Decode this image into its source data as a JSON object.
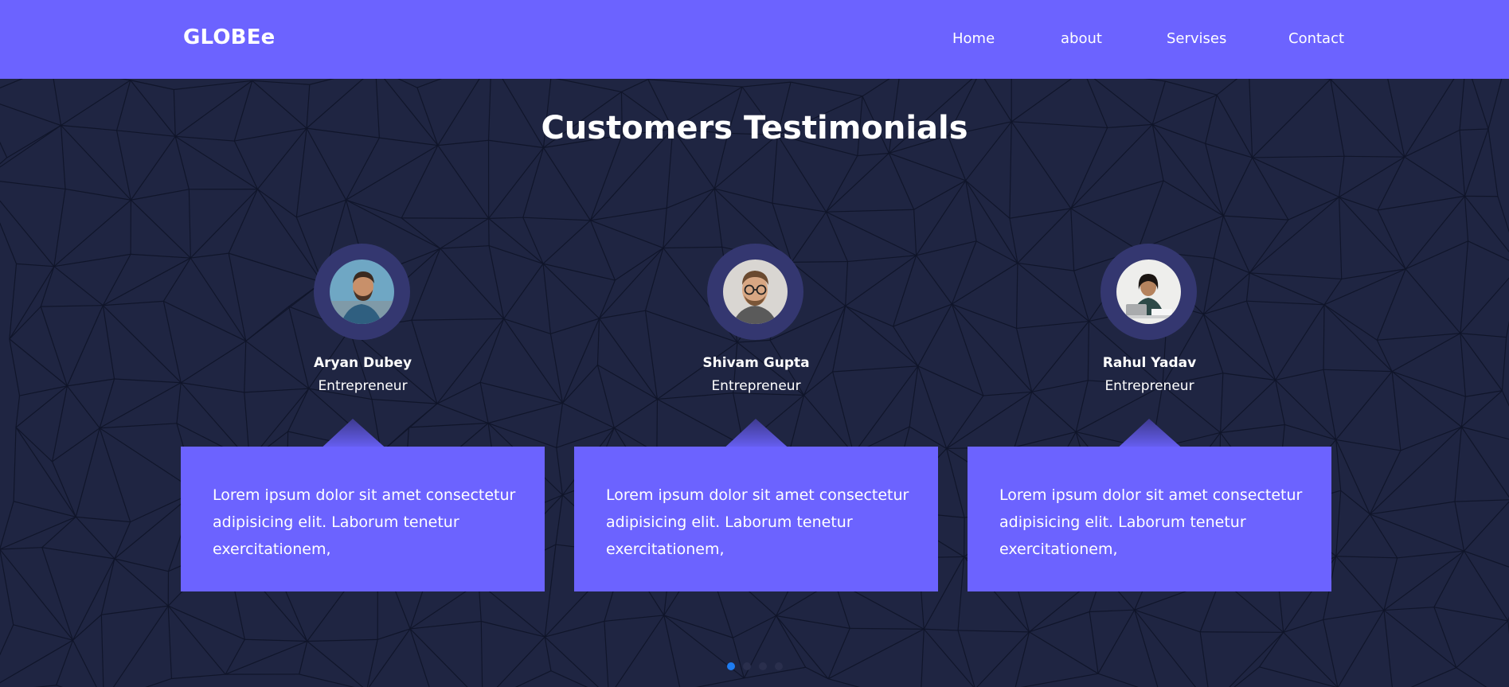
{
  "header": {
    "brand": "GLOBEe",
    "nav": [
      {
        "label": "Home"
      },
      {
        "label": "about"
      },
      {
        "label": "Servises"
      },
      {
        "label": "Contact"
      }
    ]
  },
  "section": {
    "title": "Customers Testimonials"
  },
  "testimonials": [
    {
      "name": "Aryan Dubey",
      "role": "Entrepreneur",
      "text": "Lorem ipsum dolor sit amet consectetur adipisicing elit. Laborum tenetur exercitationem,",
      "avatar_icon": "man-beard-portrait"
    },
    {
      "name": "Shivam Gupta",
      "role": "Entrepreneur",
      "text": "Lorem ipsum dolor sit amet consectetur adipisicing elit. Laborum tenetur exercitationem,",
      "avatar_icon": "man-glasses-portrait"
    },
    {
      "name": "Rahul Yadav",
      "role": "Entrepreneur",
      "text": "Lorem ipsum dolor sit amet consectetur adipisicing elit. Laborum tenetur exercitationem,",
      "avatar_icon": "woman-laptop-portrait"
    }
  ],
  "carousel": {
    "pages": 4,
    "active_index": 0
  },
  "colors": {
    "accent": "#6c63ff",
    "background": "#1f2542",
    "avatar_ring": "#343770",
    "active_dot": "#1e7cf2"
  }
}
